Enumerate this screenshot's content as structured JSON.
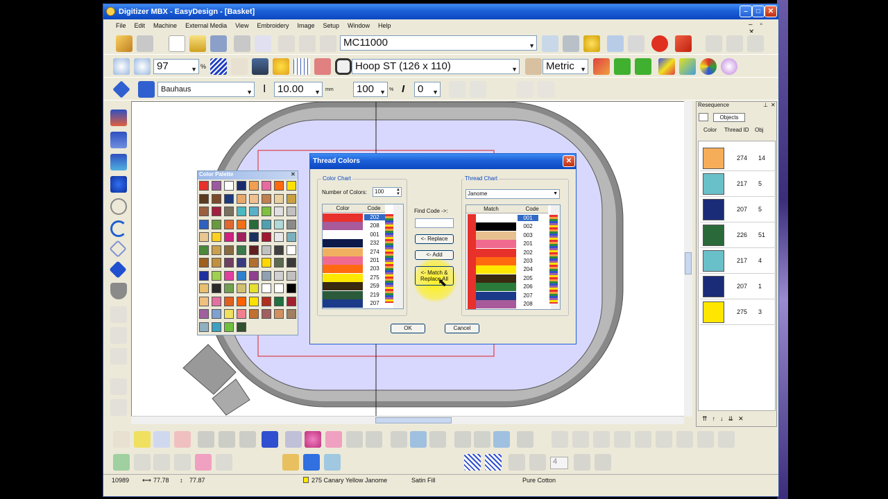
{
  "window": {
    "title": "Digitizer MBX - EasyDesign - [Basket]"
  },
  "menu": [
    "File",
    "Edit",
    "Machine",
    "External Media",
    "View",
    "Embroidery",
    "Image",
    "Setup",
    "Window",
    "Help"
  ],
  "toolbar1": {
    "design_name": "MC11000"
  },
  "toolbar2": {
    "zoom": "97",
    "zoom_unit": "%",
    "hoop": "Hoop ST (126 x 110)",
    "units": "Metric"
  },
  "toolbar3": {
    "font": "Bauhaus",
    "size": "10.00",
    "size_unit": "mm",
    "width": "100",
    "width_unit": "%",
    "italic": "0"
  },
  "color_palette": {
    "title": "Color Palette",
    "colors": [
      "#e8312a",
      "#9b5aa0",
      "#ffffff",
      "#1b2c6e",
      "#f0a050",
      "#e86aa0",
      "#ff6a10",
      "#ffe000",
      "#5a3a20",
      "#7a4a2a",
      "#1c3a7a",
      "#e8a86a",
      "#f0c090",
      "#c08050",
      "#e8d0a0",
      "#c8a040",
      "#9a6040",
      "#a02040",
      "#7a7060",
      "#4ab8c0",
      "#5ab0c8",
      "#80c040",
      "#e0e0e0",
      "#c0c0c0",
      "#3060c0",
      "#6a9a40",
      "#e06830",
      "#f07018",
      "#2a6a3a",
      "#50a0b0",
      "#b0d8d8",
      "#8a8a8a",
      "#e8c890",
      "#ffd020",
      "#d02080",
      "#a02060",
      "#1a3060",
      "#a01830",
      "#e8e8e8",
      "#7ab0c0",
      "#4a8a3a",
      "#c8a050",
      "#8a6a40",
      "#3a7a4a",
      "#602020",
      "#c0c0c0",
      "#404040",
      "#ffffff",
      "#a06020",
      "#c09040",
      "#704060",
      "#3a3a80",
      "#b07030",
      "#ffd800",
      "#5a6a50",
      "#3a3a3a",
      "#2030a0",
      "#a0d050",
      "#e040a0",
      "#3080d0",
      "#904090",
      "#90a0b0",
      "#d0d0d0",
      "#c0c0c0",
      "#e8c070",
      "#2a2a2a",
      "#70a050",
      "#d0c070",
      "#e8e030",
      "#ffffff",
      "#ffffff",
      "#000000",
      "#f0c080",
      "#e070a0",
      "#e06020",
      "#ff6000",
      "#ffe000",
      "#b03020",
      "#207040",
      "#a02030",
      "#a060a0",
      "#80a0d0",
      "#f0e060",
      "#f08090",
      "#c07030",
      "#a06060",
      "#d09060",
      "#a08060",
      "#90b0c0",
      "#40a0c0",
      "#70c040",
      "#305030"
    ]
  },
  "thread_colors_dialog": {
    "title": "Thread Colors",
    "color_chart_label": "Color Chart",
    "num_colors_label": "Number of Colors:",
    "num_colors": "100",
    "col_color": "Color",
    "col_code": "Code",
    "left_rows": [
      {
        "color": "#e8312a",
        "code": "202"
      },
      {
        "color": "#a85a9a",
        "code": "208"
      },
      {
        "color": "#ffffff",
        "code": "001"
      },
      {
        "color": "#0c1a4a",
        "code": "232"
      },
      {
        "color": "#f0b060",
        "code": "274"
      },
      {
        "color": "#f06a90",
        "code": "201"
      },
      {
        "color": "#ff6a10",
        "code": "203"
      },
      {
        "color": "#ffe800",
        "code": "275"
      },
      {
        "color": "#3a2a10",
        "code": "259"
      },
      {
        "color": "#2a5a3a",
        "code": "219"
      },
      {
        "color": "#1c3a8a",
        "code": "207"
      }
    ],
    "find_code_label": "Find Code ->:",
    "replace_button": "<- Replace",
    "add_button": "<- Add",
    "match_replace_button": "<- Match & Replace All",
    "thread_chart_label": "Thread Chart",
    "thread_brand": "Janome",
    "col_match": "Match",
    "right_rows": [
      {
        "color": "#ffffff",
        "code": "001"
      },
      {
        "color": "#000000",
        "code": "002"
      },
      {
        "color": "#e8c090",
        "code": "003"
      },
      {
        "color": "#f06a90",
        "code": "201"
      },
      {
        "color": "#e8312a",
        "code": "202"
      },
      {
        "color": "#ff6a10",
        "code": "203"
      },
      {
        "color": "#ffe800",
        "code": "204"
      },
      {
        "color": "#3a2a10",
        "code": "205"
      },
      {
        "color": "#2a7a3a",
        "code": "206"
      },
      {
        "color": "#1c3a8a",
        "code": "207"
      },
      {
        "color": "#a85a9a",
        "code": "208"
      }
    ],
    "ok_button": "OK",
    "cancel_button": "Cancel"
  },
  "resequence": {
    "title": "Resequence",
    "tab": "Objects",
    "col_color": "Color",
    "col_thread": "Thread ID",
    "col_obj": "Obj",
    "rows": [
      {
        "color": "#f5ad5a",
        "thread": "274",
        "obj": "14"
      },
      {
        "color": "#6ac0c8",
        "thread": "217",
        "obj": "5"
      },
      {
        "color": "#1a2c78",
        "thread": "207",
        "obj": "5"
      },
      {
        "color": "#2a6a3a",
        "thread": "226",
        "obj": "51"
      },
      {
        "color": "#6ac0c8",
        "thread": "217",
        "obj": "4"
      },
      {
        "color": "#1a2c78",
        "thread": "207",
        "obj": "1"
      },
      {
        "color": "#ffe600",
        "thread": "275",
        "obj": "3"
      }
    ]
  },
  "status": {
    "stitches": "10989",
    "width": "77.78",
    "height": "77.87",
    "thread": "275 Canary Yellow Janome",
    "fill": "Satin Fill",
    "fabric": "Pure Cotton",
    "step": "4"
  }
}
